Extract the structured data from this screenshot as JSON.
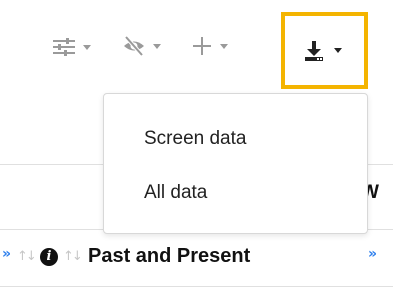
{
  "toolbar": {
    "buttons": [
      {
        "name": "filter-settings",
        "icon": "sliders-icon"
      },
      {
        "name": "column-visibility",
        "icon": "eye-slash-icon"
      },
      {
        "name": "add",
        "icon": "plus-icon"
      },
      {
        "name": "download",
        "icon": "download-icon",
        "active": true
      }
    ],
    "accent_color": "#f4b400"
  },
  "download_menu": {
    "items": [
      {
        "label": "Screen data"
      },
      {
        "label": "All data"
      }
    ]
  },
  "table_header": {
    "peek_text": "W",
    "column_title": "Past and Present",
    "sort_color": "#c7c7c7",
    "chevron_color": "#2f80ed"
  }
}
